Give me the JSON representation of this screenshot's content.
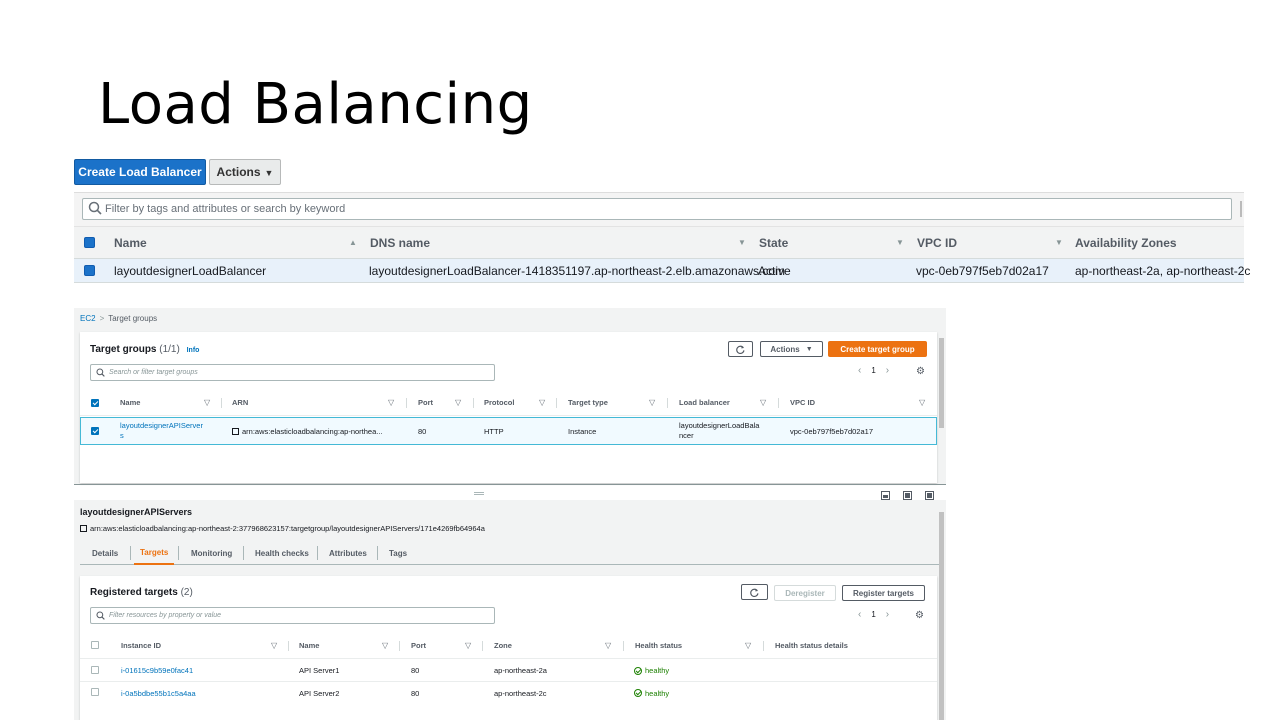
{
  "slide_title": "Load Balancing",
  "top": {
    "create_label": "Create Load Balancer",
    "actions_label": "Actions",
    "search_placeholder": "Filter by tags and attributes or search by keyword",
    "columns": [
      "Name",
      "DNS name",
      "State",
      "VPC ID",
      "Availability Zones"
    ],
    "row": {
      "name": "layoutdesignerLoadBalancer",
      "dns": "layoutdesignerLoadBalancer-1418351197.ap-northeast-2.elb.amazonaws.com",
      "state": "Active",
      "vpc": "vpc-0eb797f5eb7d02a17",
      "zones": "ap-northeast-2a, ap-northeast-2c"
    }
  },
  "target_groups": {
    "breadcrumb": [
      "EC2",
      "Target groups"
    ],
    "title": "Target groups",
    "count": "(1/1)",
    "info": "Info",
    "actions_label": "Actions",
    "create_label": "Create target group",
    "search_placeholder": "Search or filter target groups",
    "page": "1",
    "columns": [
      "Name",
      "ARN",
      "Port",
      "Protocol",
      "Target type",
      "Load balancer",
      "VPC ID"
    ],
    "row": {
      "name_line1": "layoutdesignerAPIServer",
      "name_line2": "s",
      "arn": "arn:aws:elasticloadbalancing:ap-northea...",
      "port": "80",
      "protocol": "HTTP",
      "target_type": "Instance",
      "lb_line1": "layoutdesignerLoadBala",
      "lb_line2": "ncer",
      "vpc": "vpc-0eb797f5eb7d02a17"
    }
  },
  "details": {
    "title": "layoutdesignerAPIServers",
    "arn": "arn:aws:elasticloadbalancing:ap-northeast-2:377968623157:targetgroup/layoutdesignerAPIServers/171e4269fb64964a",
    "tabs": [
      "Details",
      "Targets",
      "Monitoring",
      "Health checks",
      "Attributes",
      "Tags"
    ],
    "active_tab": "Targets",
    "registered": {
      "title": "Registered targets",
      "count": "(2)",
      "deregister_label": "Deregister",
      "register_label": "Register targets",
      "search_placeholder": "Filter resources by property or value",
      "page": "1",
      "columns": [
        "Instance ID",
        "Name",
        "Port",
        "Zone",
        "Health status",
        "Health status details"
      ],
      "rows": [
        {
          "id": "i-01615c9b59e0fac41",
          "name": "API Server1",
          "port": "80",
          "zone": "ap-northeast-2a",
          "health": "healthy",
          "details": ""
        },
        {
          "id": "i-0a5bdbe55b1c5a4aa",
          "name": "API Server2",
          "port": "80",
          "zone": "ap-northeast-2c",
          "health": "healthy",
          "details": ""
        }
      ]
    }
  },
  "colors": {
    "primary_blue": "#1b72c9",
    "aws_orange": "#ec7211",
    "link_blue": "#0073bb",
    "healthy_green": "#1d8102"
  }
}
